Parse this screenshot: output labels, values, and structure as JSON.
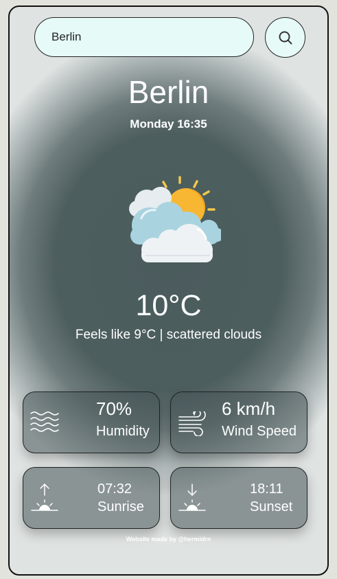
{
  "search": {
    "value": "Berlin",
    "icon": "search-icon"
  },
  "location": {
    "city": "Berlin",
    "datetime": "Monday 16:35"
  },
  "weather": {
    "icon": "sun-behind-clouds-icon",
    "temperature": "10°C",
    "description": "Feels like 9°C | scattered clouds"
  },
  "stats": {
    "humidity": {
      "value": "70%",
      "label": "Humidity",
      "icon": "humidity-waves-icon"
    },
    "wind": {
      "value": "6 km/h",
      "label": "Wind Speed",
      "icon": "wind-icon"
    },
    "sunrise": {
      "value": "07:32",
      "label": "Sunrise",
      "icon": "sunrise-icon"
    },
    "sunset": {
      "value": "18:11",
      "label": "Sunset",
      "icon": "sunset-icon"
    }
  },
  "footer": {
    "credit": "Website made by @hermidrn"
  }
}
